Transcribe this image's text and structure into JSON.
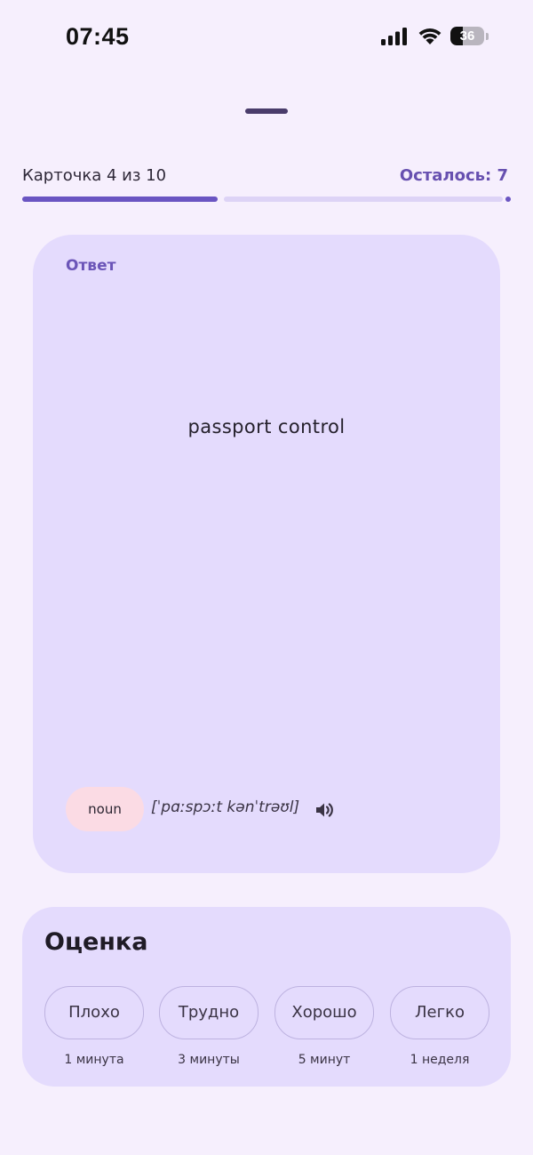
{
  "status_bar": {
    "time": "07:45",
    "battery_level": "36",
    "battery_fraction": 0.36
  },
  "progress": {
    "label": "Карточка 4 из 10",
    "remaining": "Осталось: 7",
    "fraction": 0.4
  },
  "card": {
    "side_label": "Ответ",
    "word": "passport control",
    "part_of_speech": "noun",
    "transcription": "[ˈpɑːspɔːt kənˈtrəʊl]",
    "speaker_icon": "volume-up-icon"
  },
  "rating": {
    "title": "Оценка",
    "options": [
      {
        "label": "Плохо",
        "interval": "1 минута"
      },
      {
        "label": "Трудно",
        "interval": "3 минуты"
      },
      {
        "label": "Хорошо",
        "interval": "5 минут"
      },
      {
        "label": "Легко",
        "interval": "1 неделя"
      }
    ]
  },
  "colors": {
    "accent": "#6a55c2",
    "background": "#f6effd",
    "card": "#e4dbfd",
    "chip": "#fbdbe4"
  }
}
